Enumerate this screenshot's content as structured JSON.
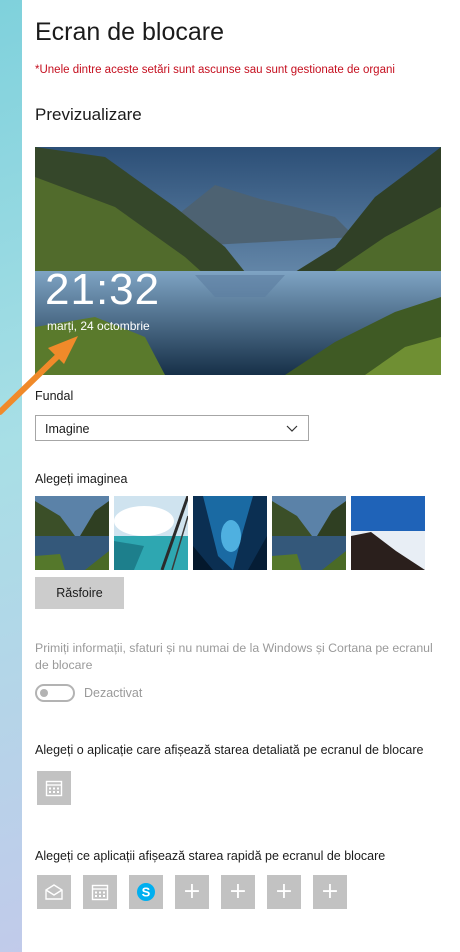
{
  "page": {
    "title": "Ecran de blocare",
    "warning": "*Unele dintre aceste setări sunt ascunse sau sunt gestionate de organi",
    "preview_heading": "Previzualizare"
  },
  "preview": {
    "time": "21:32",
    "date": "marți, 24 octombrie"
  },
  "background": {
    "label": "Fundal",
    "selected": "Imagine"
  },
  "choose_image": {
    "label": "Alegeți imaginea",
    "thumbnails": [
      "lake-mountains",
      "beach-rope",
      "ice-cave",
      "lake-mountains",
      "mountain-ridge-sky"
    ],
    "browse_label": "Răsfoire"
  },
  "tips": {
    "text": "Primiți informații, sfaturi și nu numai de la Windows și Cortana pe ecranul de blocare",
    "toggle_state": "Dezactivat",
    "toggle_on": false
  },
  "detailed_status": {
    "label": "Alegeți o aplicație care afișează starea detaliată pe ecranul de blocare",
    "app_icon": "calendar-icon"
  },
  "quick_status": {
    "label": "Alegeți ce aplicații afișează starea rapidă pe ecranul de blocare",
    "apps": [
      "mail-icon",
      "calendar-icon",
      "skype-icon",
      "plus-icon",
      "plus-icon",
      "plus-icon",
      "plus-icon"
    ],
    "plus_symbol": "+"
  },
  "colors": {
    "warning": "#c50f1f",
    "tile": "#c2c2c2",
    "arrow": "#f08a2a",
    "skype": "#00aff0"
  }
}
